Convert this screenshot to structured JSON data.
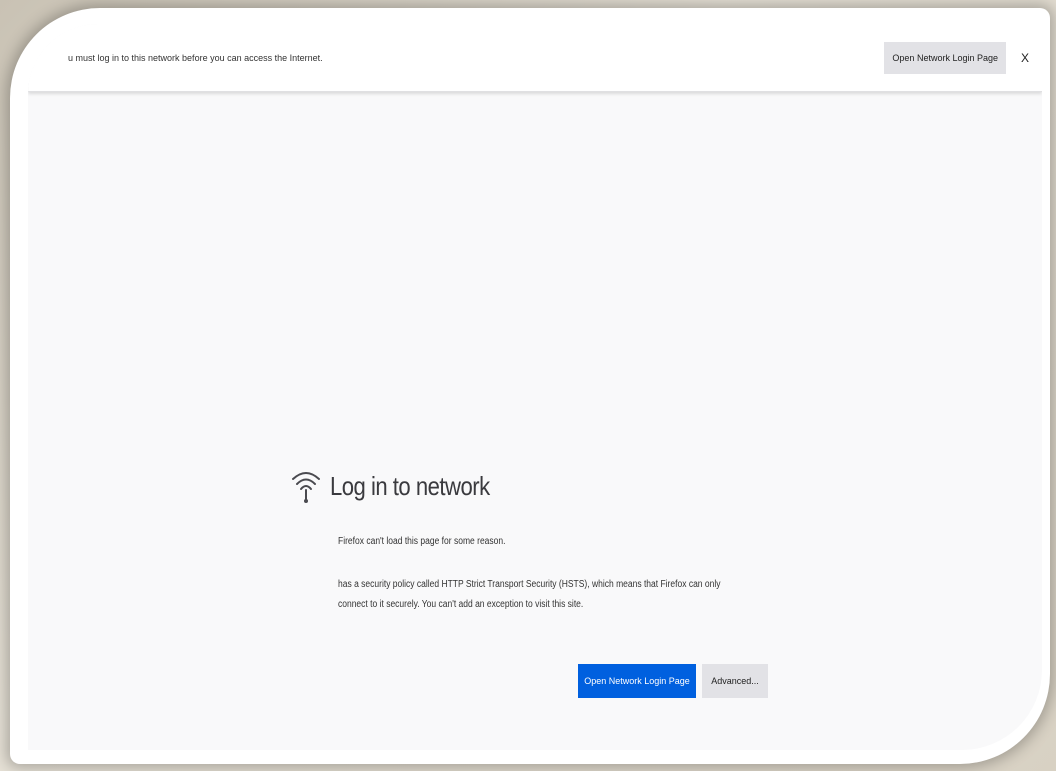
{
  "notification": {
    "message": "u must log in to this network before you can access the Internet.",
    "button_label": "Open Network Login Page",
    "close_label": "X"
  },
  "error": {
    "title": "Log in to network",
    "description": "Firefox can't load this page for some reason.",
    "detail": "has a security policy called HTTP Strict Transport Security (HSTS), which means that Firefox can only connect to it securely. You can't add an exception to visit this site.",
    "primary_button": "Open Network Login Page",
    "secondary_button": "Advanced..."
  },
  "colors": {
    "primary": "#0060df",
    "background": "#f9f9fa"
  },
  "icons": {
    "title_icon": "wifi-icon"
  }
}
